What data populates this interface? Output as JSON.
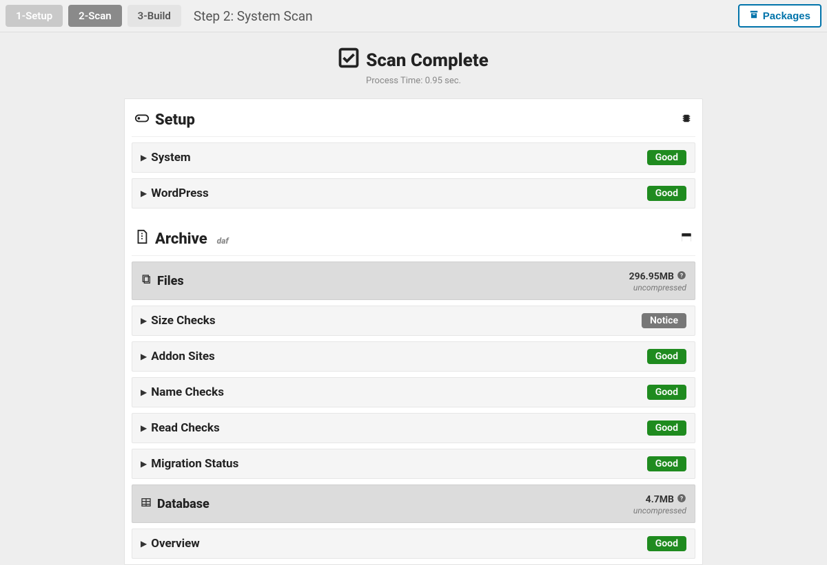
{
  "topbar": {
    "steps": {
      "s1": "1-Setup",
      "s2": "2-Scan",
      "s3": "3-Build"
    },
    "title": "Step 2: System Scan",
    "packages": "Packages"
  },
  "scan": {
    "title": "Scan Complete",
    "process_time": "Process Time: 0.95 sec."
  },
  "setup": {
    "title": "Setup",
    "rows": {
      "system": {
        "label": "System",
        "status": "Good"
      },
      "wordpress": {
        "label": "WordPress",
        "status": "Good"
      }
    }
  },
  "archive": {
    "title": "Archive",
    "sub": "daf",
    "files": {
      "label": "Files",
      "size": "296.95MB",
      "note": "uncompressed"
    },
    "rows": {
      "size_checks": {
        "label": "Size Checks",
        "status": "Notice"
      },
      "addon_sites": {
        "label": "Addon Sites",
        "status": "Good"
      },
      "name_checks": {
        "label": "Name Checks",
        "status": "Good"
      },
      "read_checks": {
        "label": "Read Checks",
        "status": "Good"
      },
      "migration_status": {
        "label": "Migration Status",
        "status": "Good"
      }
    },
    "database": {
      "label": "Database",
      "size": "4.7MB",
      "note": "uncompressed"
    },
    "db_rows": {
      "overview": {
        "label": "Overview",
        "status": "Good"
      }
    }
  }
}
